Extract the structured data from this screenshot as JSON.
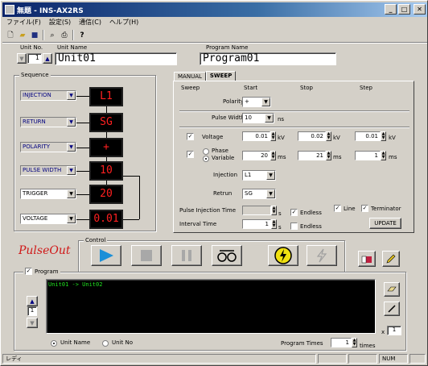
{
  "window": {
    "title": "無題 - INS-AX2RS"
  },
  "menu": [
    "ファイル(F)",
    "設定(S)",
    "通信(C)",
    "ヘルプ(H)"
  ],
  "unit": {
    "no_label": "Unit No.",
    "no_value": "1",
    "name_label": "Unit Name",
    "name_value": "Unit01"
  },
  "program": {
    "name_label": "Program Name",
    "name_value": "Program01"
  },
  "sequence": {
    "title": "Sequence",
    "rows": [
      {
        "label": "INJECTION",
        "display": "L1"
      },
      {
        "label": "RETURN",
        "display": "SG"
      },
      {
        "label": "POLARITY",
        "display": "+"
      },
      {
        "label": "PULSE WIDTH",
        "display": "10"
      },
      {
        "label": "TRIGGER",
        "display": "20"
      },
      {
        "label": "VOLTAGE",
        "display": "0.01"
      }
    ]
  },
  "tabs": {
    "manual": "MANUAL",
    "sweep": "SWEEP"
  },
  "sweep": {
    "col_sweep": "Sweep",
    "col_start": "Start",
    "col_stop": "Stop",
    "col_step": "Step",
    "polarity_label": "Polarity",
    "polarity_value": "+",
    "pulse_width_label": "Pulse Width",
    "pulse_width_value": "10",
    "pulse_width_unit": "ns",
    "voltage_label": "Voltage",
    "voltage_start": "0.01",
    "voltage_stop": "0.02",
    "voltage_step": "0.01",
    "kv": "kV",
    "phase_label": "Phase",
    "variable_label": "Variable",
    "phase_start": "20",
    "phase_stop": "21",
    "phase_step": "1",
    "ms": "ms",
    "injection_label": "Injection",
    "injection_value": "L1",
    "return_label": "Retrun",
    "return_value": "SG",
    "pit_label": "Pulse Injection Time",
    "pit_value": "",
    "s": "s",
    "interval_label": "Interval Time",
    "interval_value": "1",
    "endless": "Endless",
    "line": "Line",
    "terminator": "Terminator",
    "update": "UPDATE"
  },
  "logo": "PulseOut",
  "control": {
    "title": "Control"
  },
  "program_panel": {
    "title": "Program",
    "text": "Unit01  ->  Unit02",
    "page": "1",
    "unit_name": "Unit Name",
    "unit_no": "Unit No",
    "times_label": "Program Times",
    "times_value": "1",
    "times_unit": "times",
    "x_label": "x",
    "x_value": "1"
  },
  "status": {
    "text": "レディ",
    "num": "NUM"
  }
}
